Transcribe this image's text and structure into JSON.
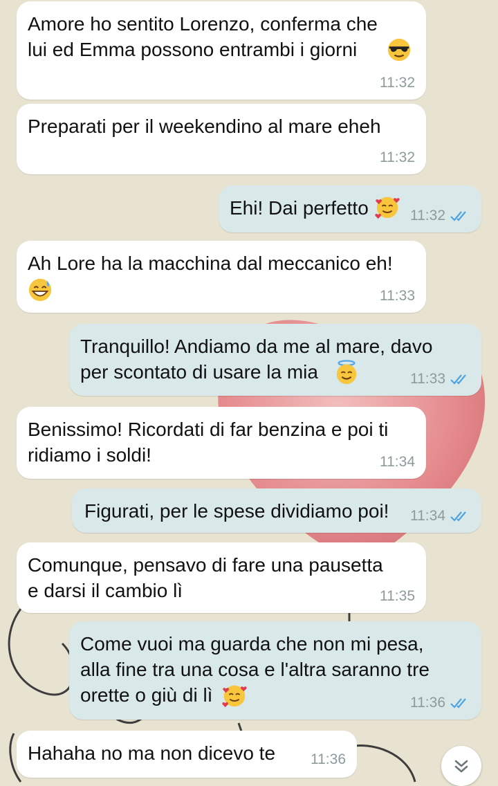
{
  "messages": [
    {
      "text": "Amore ho sentito Lorenzo, conferma che\nlui ed Emma possono entrambi i giorni",
      "emoji": "sunglasses-face",
      "time": "11:32",
      "direction": "incoming"
    },
    {
      "text": "Preparati per il weekendino al mare eheh",
      "time": "11:32",
      "direction": "incoming"
    },
    {
      "text": "Ehi! Dai perfetto",
      "emoji": "smiling-face-with-hearts",
      "time": "11:32",
      "direction": "outgoing",
      "read": true
    },
    {
      "text": "Ah Lore ha la macchina dal meccanico eh!",
      "emoji": "grinning-sweat-face",
      "time": "11:33",
      "direction": "incoming"
    },
    {
      "text": "Tranquillo! Andiamo da me al mare, davo\nper scontato di usare la mia",
      "emoji": "halo-face",
      "time": "11:33",
      "direction": "outgoing",
      "read": true
    },
    {
      "text": "Benissimo! Ricordati di far benzina e poi ti\nridiamo i soldi!",
      "time": "11:34",
      "direction": "incoming"
    },
    {
      "text": "Figurati, per le spese dividiamo poi!",
      "time": "11:34",
      "direction": "outgoing",
      "read": true
    },
    {
      "text": "Comunque, pensavo di fare una pausetta\ne darsi il cambio lì",
      "time": "11:35",
      "direction": "incoming"
    },
    {
      "text": "Come vuoi ma guarda che non mi pesa,\nalla fine tra una cosa e l'altra saranno tre\norette o giù di lì",
      "emoji": "smiling-face-with-hearts",
      "time": "11:36",
      "direction": "outgoing",
      "read": true
    },
    {
      "text": "Hahaha no ma non dicevo te",
      "time": "11:36",
      "direction": "incoming"
    }
  ],
  "scroll_button_icon": "double-chevron-down-icon",
  "colors": {
    "incoming_bubble": "#ffffff",
    "outgoing_bubble": "#d9e9ea",
    "read_ticks": "#4fa3e0",
    "timestamp": "#8c9a9c"
  }
}
